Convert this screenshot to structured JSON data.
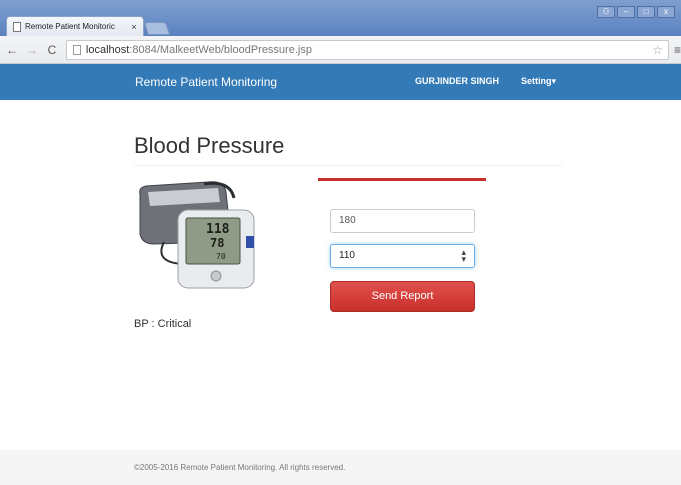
{
  "browser": {
    "tab_title": "Remote Patient Monitoric",
    "tab_close": "×",
    "url_host": "localhost",
    "url_path": ":8084/MalkeetWeb/bloodPressure.jsp"
  },
  "navbar": {
    "brand": "Remote Patient Monitoring",
    "user": "GURJINDER SINGH",
    "settings": "Setting▾"
  },
  "page": {
    "title": "Blood Pressure",
    "systolic_value": "180",
    "diastolic_value": "110",
    "send_button": "Send Report",
    "status": "BP : Critical"
  },
  "monitor_display": {
    "top_reading": "118",
    "bottom_reading": "78",
    "pulse_reading": "70"
  },
  "footer": {
    "copyright": "©2005-2016 Remote Patient Monitoring. All rights reserved."
  },
  "colors": {
    "navbar": "#337ab7",
    "button": "#c9302c",
    "accent_rule": "#c9302c"
  }
}
